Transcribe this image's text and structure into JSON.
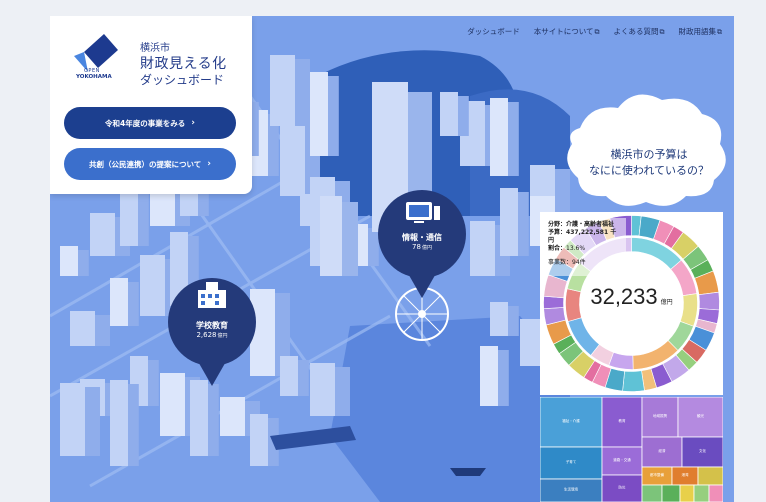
{
  "header": {
    "logo_sub_open": "OPEN",
    "logo_sub_city": "YOKOHAMA",
    "city": "横浜市",
    "title": "財政見える化",
    "subtitle": "ダッシュボード"
  },
  "buttons": {
    "primary": "令和4年度の事業をみる",
    "secondary": "共創（公民連携）の提案について"
  },
  "nav": {
    "dashboard": "ダッシュボード",
    "about": "本サイトについて",
    "faq": "よくある質問",
    "glossary": "財政用語集"
  },
  "cloud": {
    "line1": "横浜市の予算は",
    "line2": "なにに使われているの？"
  },
  "pins": {
    "info": {
      "label": "情報・通信",
      "value": "78",
      "unit": "億円"
    },
    "school": {
      "label": "学校教育",
      "value": "2,628",
      "unit": "億円"
    }
  },
  "donut": {
    "total": "32,233",
    "unit": "億円",
    "tooltip": {
      "field_label": "分野：",
      "field": "介護・高齢者福祉",
      "budget_label": "予算：",
      "budget": "437,222,581 千円",
      "ratio_label": "割合：",
      "ratio": "13.6%",
      "count_label": "事業数：",
      "count": "94件"
    }
  },
  "treemap": {
    "labels": [
      "福祉・介護",
      "子育て",
      "生活環境",
      "教育",
      "道路・交通",
      "防災",
      "地域振興",
      "観光",
      "経済",
      "文化",
      "都市整備",
      "港湾"
    ]
  },
  "colors": {
    "primary_button": "#1c3f8f",
    "secondary_button": "#3b6fcc",
    "city_blue": "#6f97e6",
    "pin": "#243a7a"
  }
}
